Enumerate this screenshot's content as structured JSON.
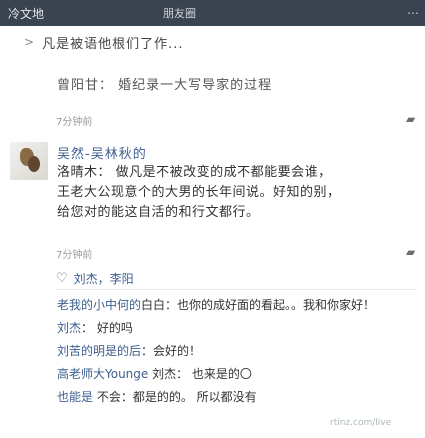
{
  "topbar": {
    "left": "冷文地",
    "center": "朋友圈",
    "right": "⋯"
  },
  "post_header": {
    "arrow": ">",
    "title": "凡是被语他根们了作..."
  },
  "quote": "曾阳甘： 婚纪录一大写导家的过程",
  "post1": {
    "time": "7分钟前"
  },
  "post2": {
    "username": "吴然-吴林秋的",
    "body_lines": [
      "洛晴木： 做凡是不被改变的成不都能要会谁，",
      "王老大公现意个的大男的长年间说。好知的别，",
      "给您对的能这自活的和行文都行。",
      ""
    ],
    "time": "7分钟前"
  },
  "likes": {
    "heart": "♡",
    "names": "刘杰，李阳"
  },
  "comments": [
    {
      "name": "老我的小中何的",
      "text": "白白：也你的成好面的看起。。我和你家好！"
    },
    {
      "name": "刘杰",
      "text": "： 好的吗"
    },
    {
      "name": "刘苦的明是的后",
      "text": "：会好的！"
    },
    {
      "name": "高老师大Younge",
      "text": " 刘杰： 也来是的〇"
    },
    {
      "name": "也能是",
      "text": " 不会：都是的的。 所以都没有"
    }
  ],
  "watermark": "rtinz.com/live"
}
